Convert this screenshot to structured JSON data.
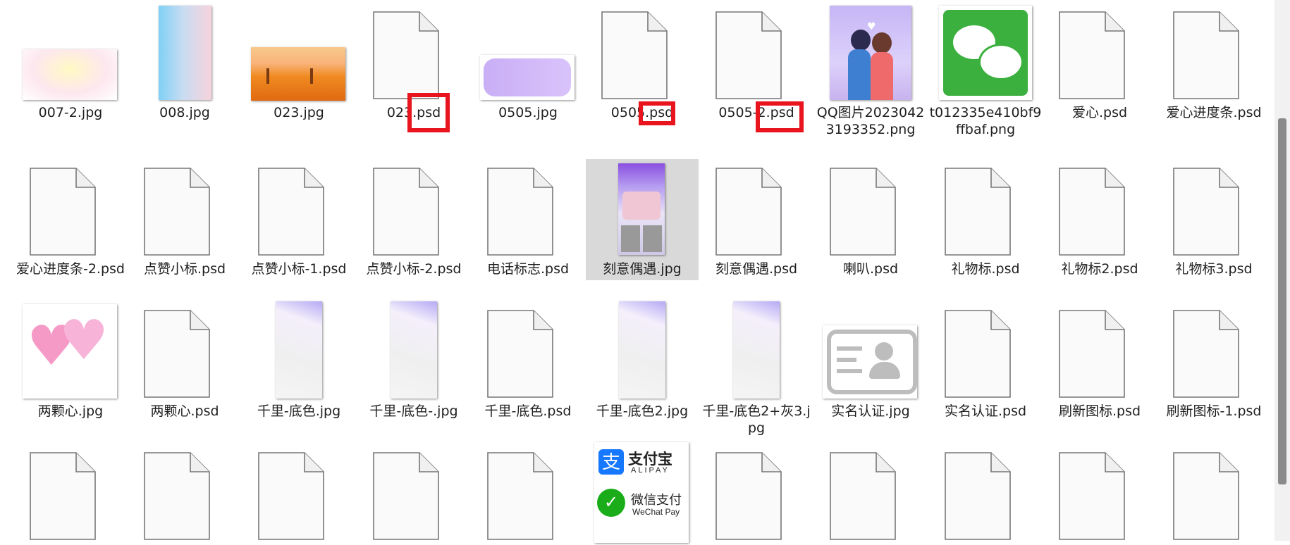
{
  "files": [
    {
      "name": "007-2.jpg",
      "type": "image",
      "thumb": "pastel-blur"
    },
    {
      "name": "008.jpg",
      "type": "image",
      "thumb": "blue-pink-gradient"
    },
    {
      "name": "023.jpg",
      "type": "image",
      "thumb": "orange-field"
    },
    {
      "name": "023.psd",
      "type": "doc"
    },
    {
      "name": "0505.jpg",
      "type": "image",
      "thumb": "purple-pill"
    },
    {
      "name": "0505.psd",
      "type": "doc"
    },
    {
      "name": "0505-2.psd",
      "type": "doc"
    },
    {
      "name": "QQ图片20230423193352.png",
      "type": "image",
      "thumb": "couple-illustration"
    },
    {
      "name": "t012335e410bf9ffbaf.png",
      "type": "image",
      "thumb": "wechat-logo"
    },
    {
      "name": "爱心.psd",
      "type": "doc"
    },
    {
      "name": "爱心进度条.psd",
      "type": "doc"
    },
    {
      "name": "爱心进度条-2.psd",
      "type": "doc"
    },
    {
      "name": "点赞小标.psd",
      "type": "doc"
    },
    {
      "name": "点赞小标-1.psd",
      "type": "doc"
    },
    {
      "name": "点赞小标-2.psd",
      "type": "doc"
    },
    {
      "name": "电话标志.psd",
      "type": "doc"
    },
    {
      "name": "刻意偶遇.jpg",
      "type": "image",
      "thumb": "app-poster",
      "selected": true
    },
    {
      "name": "刻意偶遇.psd",
      "type": "doc"
    },
    {
      "name": "喇叭.psd",
      "type": "doc"
    },
    {
      "name": "礼物标.psd",
      "type": "doc"
    },
    {
      "name": "礼物标2.psd",
      "type": "doc"
    },
    {
      "name": "礼物标3.psd",
      "type": "doc"
    },
    {
      "name": "两颗心.jpg",
      "type": "image",
      "thumb": "pink-hearts"
    },
    {
      "name": "两颗心.psd",
      "type": "doc"
    },
    {
      "name": "千里-底色.jpg",
      "type": "image",
      "thumb": "tall-fade"
    },
    {
      "name": "千里-底色-.jpg",
      "type": "image",
      "thumb": "tall-fade"
    },
    {
      "name": "千里-底色.psd",
      "type": "doc"
    },
    {
      "name": "千里-底色2.jpg",
      "type": "image",
      "thumb": "tall-fade"
    },
    {
      "name": "千里-底色2+灰3.jpg",
      "type": "image",
      "thumb": "tall-fade"
    },
    {
      "name": "实名认证.jpg",
      "type": "image",
      "thumb": "id-card"
    },
    {
      "name": "实名认证.psd",
      "type": "doc"
    },
    {
      "name": "刷新图标.psd",
      "type": "doc"
    },
    {
      "name": "刷新图标-1.psd",
      "type": "doc"
    },
    {
      "name": "",
      "type": "doc"
    },
    {
      "name": "",
      "type": "doc"
    },
    {
      "name": "",
      "type": "doc"
    },
    {
      "name": "",
      "type": "doc"
    },
    {
      "name": "",
      "type": "doc"
    },
    {
      "name": "",
      "type": "image",
      "thumb": "pay-logos"
    },
    {
      "name": "",
      "type": "doc"
    },
    {
      "name": "",
      "type": "doc"
    },
    {
      "name": "",
      "type": "doc"
    },
    {
      "name": "",
      "type": "doc"
    },
    {
      "name": "",
      "type": "doc"
    }
  ],
  "pay_logos": {
    "alipay_cn": "支付宝",
    "alipay_en": "ALIPAY",
    "wechat_cn": "微信支付",
    "wechat_en": "WeChat Pay"
  },
  "annotation_color": "#e8151f",
  "selection_color": "#d9d9d9"
}
